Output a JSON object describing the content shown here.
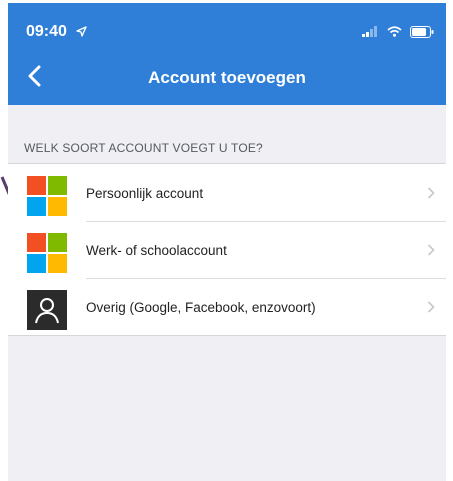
{
  "status_bar": {
    "time": "09:40"
  },
  "nav": {
    "back_label": "",
    "title": "Account toevoegen"
  },
  "section": {
    "header": "WELK SOORT ACCOUNT VOEGT U TOE?"
  },
  "accounts": [
    {
      "label": "Persoonlijk account",
      "icon": "microsoft-logo-icon"
    },
    {
      "label": "Werk- of schoolaccount",
      "icon": "microsoft-logo-icon"
    },
    {
      "label": "Overig (Google, Facebook, enzovoort)",
      "icon": "person-icon"
    }
  ],
  "colors": {
    "header_blue": "#2f7fd8",
    "background": "#efeff4",
    "ms_red": "#f25022",
    "ms_green": "#7fba00",
    "ms_blue": "#00a4ef",
    "ms_yellow": "#ffb900",
    "annotation": "#5a3b6e"
  }
}
